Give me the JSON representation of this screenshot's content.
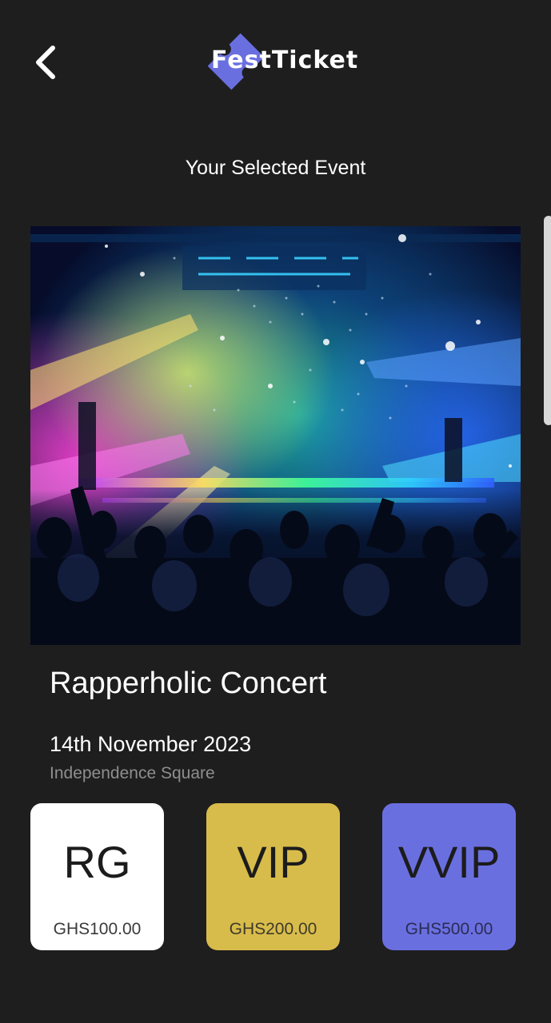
{
  "header": {
    "back_icon": "chevron-left-icon",
    "logo_text": "FestTicket",
    "logo_color": "#6a6fe0"
  },
  "section_title": "Your Selected Event",
  "event": {
    "image": "concert-crowd-stage-lights",
    "name": "Rapperholic Concert",
    "date": "14th November 2023",
    "venue": "Independence Square"
  },
  "tickets": [
    {
      "tier": "RG",
      "price": "GHS100.00",
      "color": "#ffffff"
    },
    {
      "tier": "VIP",
      "price": "GHS200.00",
      "color": "#d8bc4b"
    },
    {
      "tier": "VVIP",
      "price": "GHS500.00",
      "color": "#6a6fe0"
    }
  ],
  "colors": {
    "background": "#1e1e1e",
    "text_primary": "#ffffff",
    "text_secondary": "#8e8e8e"
  }
}
